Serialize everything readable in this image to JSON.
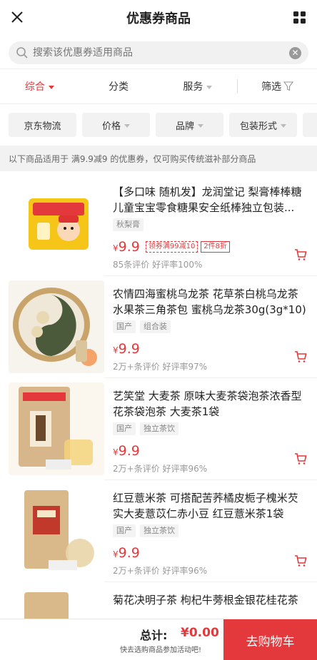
{
  "header": {
    "title": "优惠券商品"
  },
  "search": {
    "placeholder": "搜索该优惠券适用商品"
  },
  "sort": {
    "items": [
      {
        "label": "综合"
      },
      {
        "label": "分类"
      },
      {
        "label": "服务"
      },
      {
        "label": "筛选"
      }
    ]
  },
  "filters": [
    "京东物流",
    "价格",
    "品牌",
    "包装形式"
  ],
  "notice": "以下商品适用于 满9.9减9 的优惠券，仅可购买传统滋补部分商品",
  "products": [
    {
      "name": "【多口味 随机发】龙润堂记 梨膏棒棒糖儿童宝宝零食糖果安全纸棒独立包装...",
      "tags": [
        "秋梨膏"
      ],
      "price_symbol": "¥",
      "price": "9.9",
      "coupon": "领券满99减10",
      "promo": "2件8折",
      "reviews": "85条评价 好评率100%"
    },
    {
      "name": "农情四海蜜桃乌龙茶 花草茶白桃乌龙茶水果茶三角茶包 蜜桃乌龙茶30g(3g*10)",
      "tags": [
        "国产",
        "组合装"
      ],
      "price_symbol": "¥",
      "price": "9.9",
      "reviews": "2万+条评价 好评率97%"
    },
    {
      "name": "艺笑堂 大麦茶 原味大麦茶袋泡茶浓香型花茶袋泡茶 大麦茶1袋",
      "tags": [
        "国产",
        "独立茶饮"
      ],
      "price_symbol": "¥",
      "price": "9.9",
      "reviews": "2万+条评价 好评率96%"
    },
    {
      "name": "红豆薏米茶 可搭配苦荞橘皮栀子槐米芡实大麦薏苡仁赤小豆 红豆薏米茶1袋",
      "tags": [
        "国产",
        "独立茶饮"
      ],
      "price_symbol": "¥",
      "price": "9.9",
      "reviews": "2万+条评价 好评率96%"
    },
    {
      "name": "菊花决明子茶 枸杞牛蒡根金银花桂花茶"
    }
  ],
  "bottom": {
    "total_label": "总计:",
    "amount": "¥0.00",
    "hint": "快去选购商品参加活动吧!",
    "checkout": "去购物车"
  },
  "colors": {
    "accent": "#e4393c",
    "chip_bg": "#f2f2f2"
  }
}
